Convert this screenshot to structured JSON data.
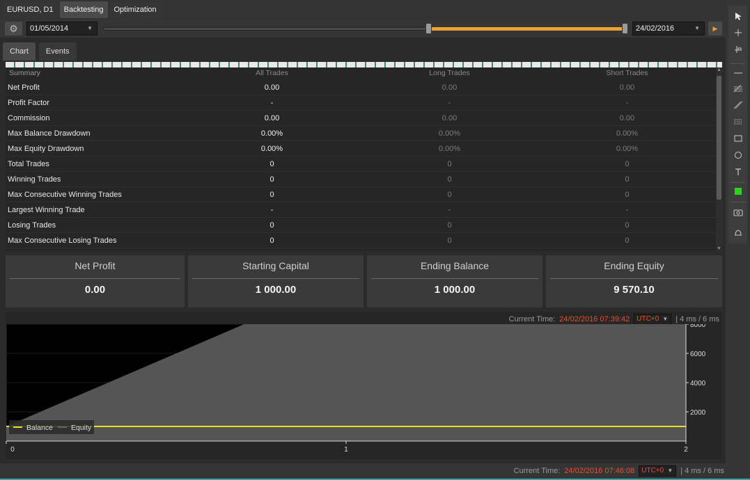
{
  "top_tabs": {
    "symbol": "EURUSD, D1",
    "backtesting": "Backtesting",
    "optimization": "Optimization"
  },
  "range": {
    "start_date": "01/05/2014",
    "end_date": "24/02/2016"
  },
  "sub_tabs": {
    "chart": "Chart",
    "events": "Events"
  },
  "stats": {
    "headers": [
      "Summary",
      "All Trades",
      "Long Trades",
      "Short Trades"
    ],
    "rows": [
      {
        "label": "Net Profit",
        "all": "0.00",
        "long": "0.00",
        "short": "0.00"
      },
      {
        "label": "Profit Factor",
        "all": "-",
        "long": "-",
        "short": "-"
      },
      {
        "label": "Commission",
        "all": "0.00",
        "long": "0.00",
        "short": "0.00"
      },
      {
        "label": "Max Balance Drawdown",
        "all": "0.00%",
        "long": "0.00%",
        "short": "0.00%"
      },
      {
        "label": "Max Equity Drawdown",
        "all": "0.00%",
        "long": "0.00%",
        "short": "0.00%"
      },
      {
        "label": "Total Trades",
        "all": "0",
        "long": "0",
        "short": "0"
      },
      {
        "label": "Winning Trades",
        "all": "0",
        "long": "0",
        "short": "0"
      },
      {
        "label": "Max Consecutive Winning Trades",
        "all": "0",
        "long": "0",
        "short": "0"
      },
      {
        "label": "Largest Winning Trade",
        "all": "-",
        "long": "-",
        "short": "-"
      },
      {
        "label": "Losing Trades",
        "all": "0",
        "long": "0",
        "short": "0"
      },
      {
        "label": "Max Consecutive Losing Trades",
        "all": "0",
        "long": "0",
        "short": "0"
      }
    ]
  },
  "cards": [
    {
      "title": "Net Profit",
      "value": "0.00"
    },
    {
      "title": "Starting Capital",
      "value": "1 000.00"
    },
    {
      "title": "Ending Balance",
      "value": "1 000.00"
    },
    {
      "title": "Ending Equity",
      "value": "9 570.10"
    }
  ],
  "status_top": {
    "label": "Current Time:",
    "time": "24/02/2016 07:39:42",
    "utc": "UTC+0",
    "ms": "| 4 ms / 6 ms"
  },
  "status_bottom": {
    "label": "Current Time:",
    "time": "24/02/2016 07:46:08",
    "utc": "UTC+0",
    "ms": "| 4 ms / 6 ms"
  },
  "colors": {
    "accent": "#f0a030",
    "balance": "#e8e020",
    "equity": "#555555",
    "time": "#e8502a"
  },
  "toolbar_icons": [
    "cursor-icon",
    "crosshair-icon",
    "zoom-icon",
    "horizontal-line-icon",
    "fibonacci-icon",
    "trendline-icon",
    "grid-icon",
    "rectangle-icon",
    "ellipse-icon",
    "text-icon",
    "color-swatch-icon",
    "camera-icon",
    "alert-bell-icon"
  ],
  "chart_data": {
    "type": "line",
    "x_ticks": [
      "0",
      "1",
      "2"
    ],
    "y_ticks": [
      "2000",
      "4000",
      "6000",
      "8000"
    ],
    "xlim": [
      0,
      2
    ],
    "ylim": [
      0,
      8000
    ],
    "legend": [
      "Balance",
      "Equity"
    ],
    "legend_position": "bottom-left",
    "series": [
      {
        "name": "Balance",
        "x": [
          0,
          2
        ],
        "y": [
          1000,
          1000
        ]
      },
      {
        "name": "Equity",
        "x": [
          0,
          0.7,
          2
        ],
        "y": [
          1000,
          9570.1,
          9570.1
        ]
      }
    ],
    "grid": true
  }
}
